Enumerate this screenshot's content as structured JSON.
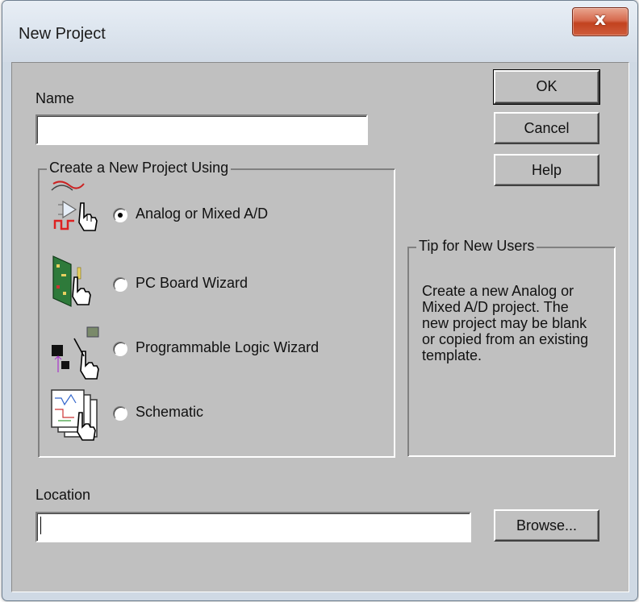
{
  "window": {
    "title": "New Project",
    "close_glyph": "x"
  },
  "name": {
    "label": "Name",
    "value": ""
  },
  "buttons": {
    "ok": "OK",
    "cancel": "Cancel",
    "help": "Help",
    "browse": "Browse..."
  },
  "create_group": {
    "legend": "Create a New Project Using",
    "options": [
      {
        "label": "Analog or Mixed A/D",
        "icon": "analog-circuit-icon",
        "selected": true
      },
      {
        "label": "PC Board Wizard",
        "icon": "pcb-board-icon",
        "selected": false
      },
      {
        "label": "Programmable Logic Wizard",
        "icon": "programmable-logic-icon",
        "selected": false
      },
      {
        "label": "Schematic",
        "icon": "schematic-pages-icon",
        "selected": false
      }
    ]
  },
  "tip": {
    "legend": "Tip for New Users",
    "lines": [
      "Create a new Analog or",
      "Mixed A/D project.  The",
      "new project may be blank",
      "or copied from an existing",
      "template."
    ]
  },
  "location": {
    "label": "Location",
    "value": ""
  },
  "colors": {
    "dialog_face": "#c0c0c0",
    "title_bar": "#d2dbe6",
    "close_button": "#c2421f"
  }
}
